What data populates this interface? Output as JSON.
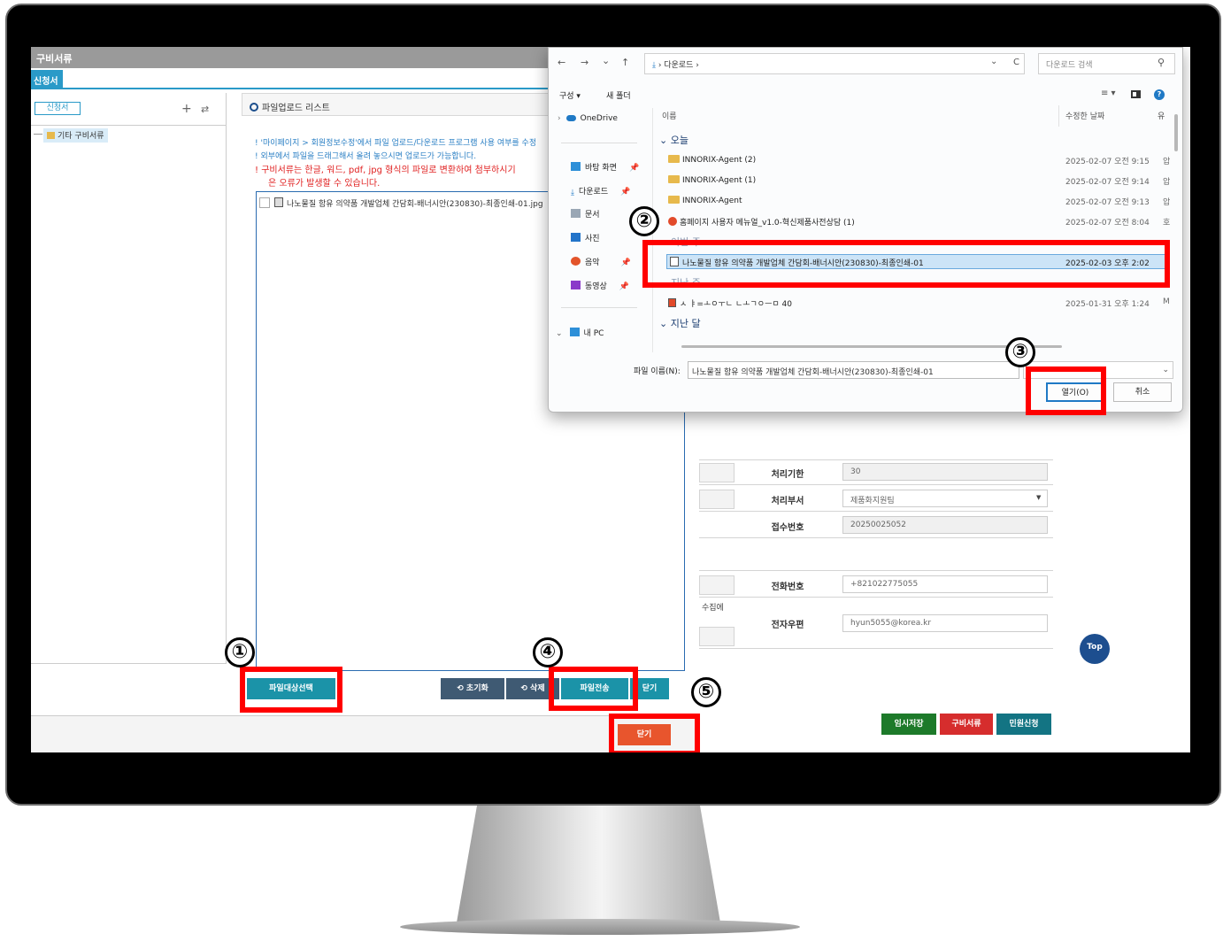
{
  "app": {
    "title": "구비서류",
    "tab_label": "신청서",
    "left_button": "신청서",
    "tree_item": "기타 구비서류",
    "plus_icon": "+",
    "tree_icon": "⇄"
  },
  "upload_panel": {
    "header": "파일업로드 리스트",
    "notices": [
      "! '마이페이지 > 회원정보수정'에서 파일 업로드/다운로드 프로그램 사용 여부를 수정",
      "! 외부에서 파일을 드래그해서 올려 놓으시면 업로드가 가능합니다.",
      "! 구비서류는 한글, 워드, pdf, jpg 형식의 파일로 변환하여 첨부하시기",
      "은 오류가 발생할 수 있습니다."
    ],
    "file_item": "나노물질 함유 의약품 개발업체 간담회-배너시안(230830)-최종인쇄-01.jpg",
    "buttons": {
      "select": "파일대상선택",
      "reset": "⟲ 초기화",
      "delete": "⟲ 삭제",
      "send": "파일전송",
      "close_inner": "닫기",
      "close": "닫기"
    }
  },
  "form": {
    "rows": [
      {
        "label": "처리기한",
        "value": "30"
      },
      {
        "label": "처리부서",
        "value": "제품화지원팀"
      },
      {
        "label": "접수번호",
        "value": "20250025052"
      },
      {
        "label": "전화번호",
        "value": "+821022775055"
      },
      {
        "label": "전자우편",
        "value": "hyun5055@korea.kr"
      }
    ],
    "partial_text": "수집에",
    "top_button": "Top",
    "actions": {
      "temp_save": "임시저장",
      "docs": "구비서류",
      "apply": "민원신청"
    }
  },
  "dialog": {
    "nav_back": "←",
    "nav_forward": "→",
    "nav_down": "⌄",
    "nav_up": "↑",
    "address": "› 다운로드 ›",
    "refresh": "C",
    "search_placeholder": "다운로드 검색",
    "search_icon": "⚲",
    "menu": {
      "organize": "구성 ▾",
      "new_folder": "새 폴더"
    },
    "view_icons": "≡ ▾",
    "help": "?",
    "col_name": "이름",
    "col_date": "수정한 날짜",
    "col_type": "유",
    "nav_items": [
      "OneDrive",
      "바탕 화면",
      "다운로드",
      "문서",
      "사진",
      "음악",
      "동영상",
      "내 PC"
    ],
    "groups": {
      "today": "오늘",
      "this_week": "이번 주",
      "last_week": "지난 주",
      "last_month": "지난 달"
    },
    "files": [
      {
        "name": "INNORIX-Agent (2)",
        "date": "2025-02-07 오전 9:15",
        "type": "압"
      },
      {
        "name": "INNORIX-Agent (1)",
        "date": "2025-02-07 오전 9:14",
        "type": "압"
      },
      {
        "name": "INNORIX-Agent",
        "date": "2025-02-07 오전 9:13",
        "type": "압"
      },
      {
        "name": "홈페이지 사용자 메뉴얼_v1.0-혁신제품사전상담 (1)",
        "date": "2025-02-07 오전 8:04",
        "type": "호"
      },
      {
        "name": "나노물질 함유 의약품 개발업체 간담회-배너시안(230830)-최종인쇄-01",
        "date": "2025-02-03 오후 2:02",
        "type": ""
      },
      {
        "name": "ㅅ ㅑ=ㅗㅇㅜㄴ ㄴㅗㄱㅇㅡㅁ 40",
        "date": "2025-01-31 오후 1:24",
        "type": "M"
      }
    ],
    "filename_label": "파일 이름(N):",
    "filename_value": "나노물질 함유 의약품 개발업체 간담회-배너시안(230830)-최종인쇄-01",
    "filetype_value": "",
    "open": "열기(O)",
    "cancel": "취소"
  },
  "annotations": [
    "①",
    "②",
    "③",
    "④",
    "⑤"
  ],
  "colors": {
    "accent": "#2a9ac8",
    "annotation_red": "#ff0000",
    "close_orange": "#e8552d"
  }
}
